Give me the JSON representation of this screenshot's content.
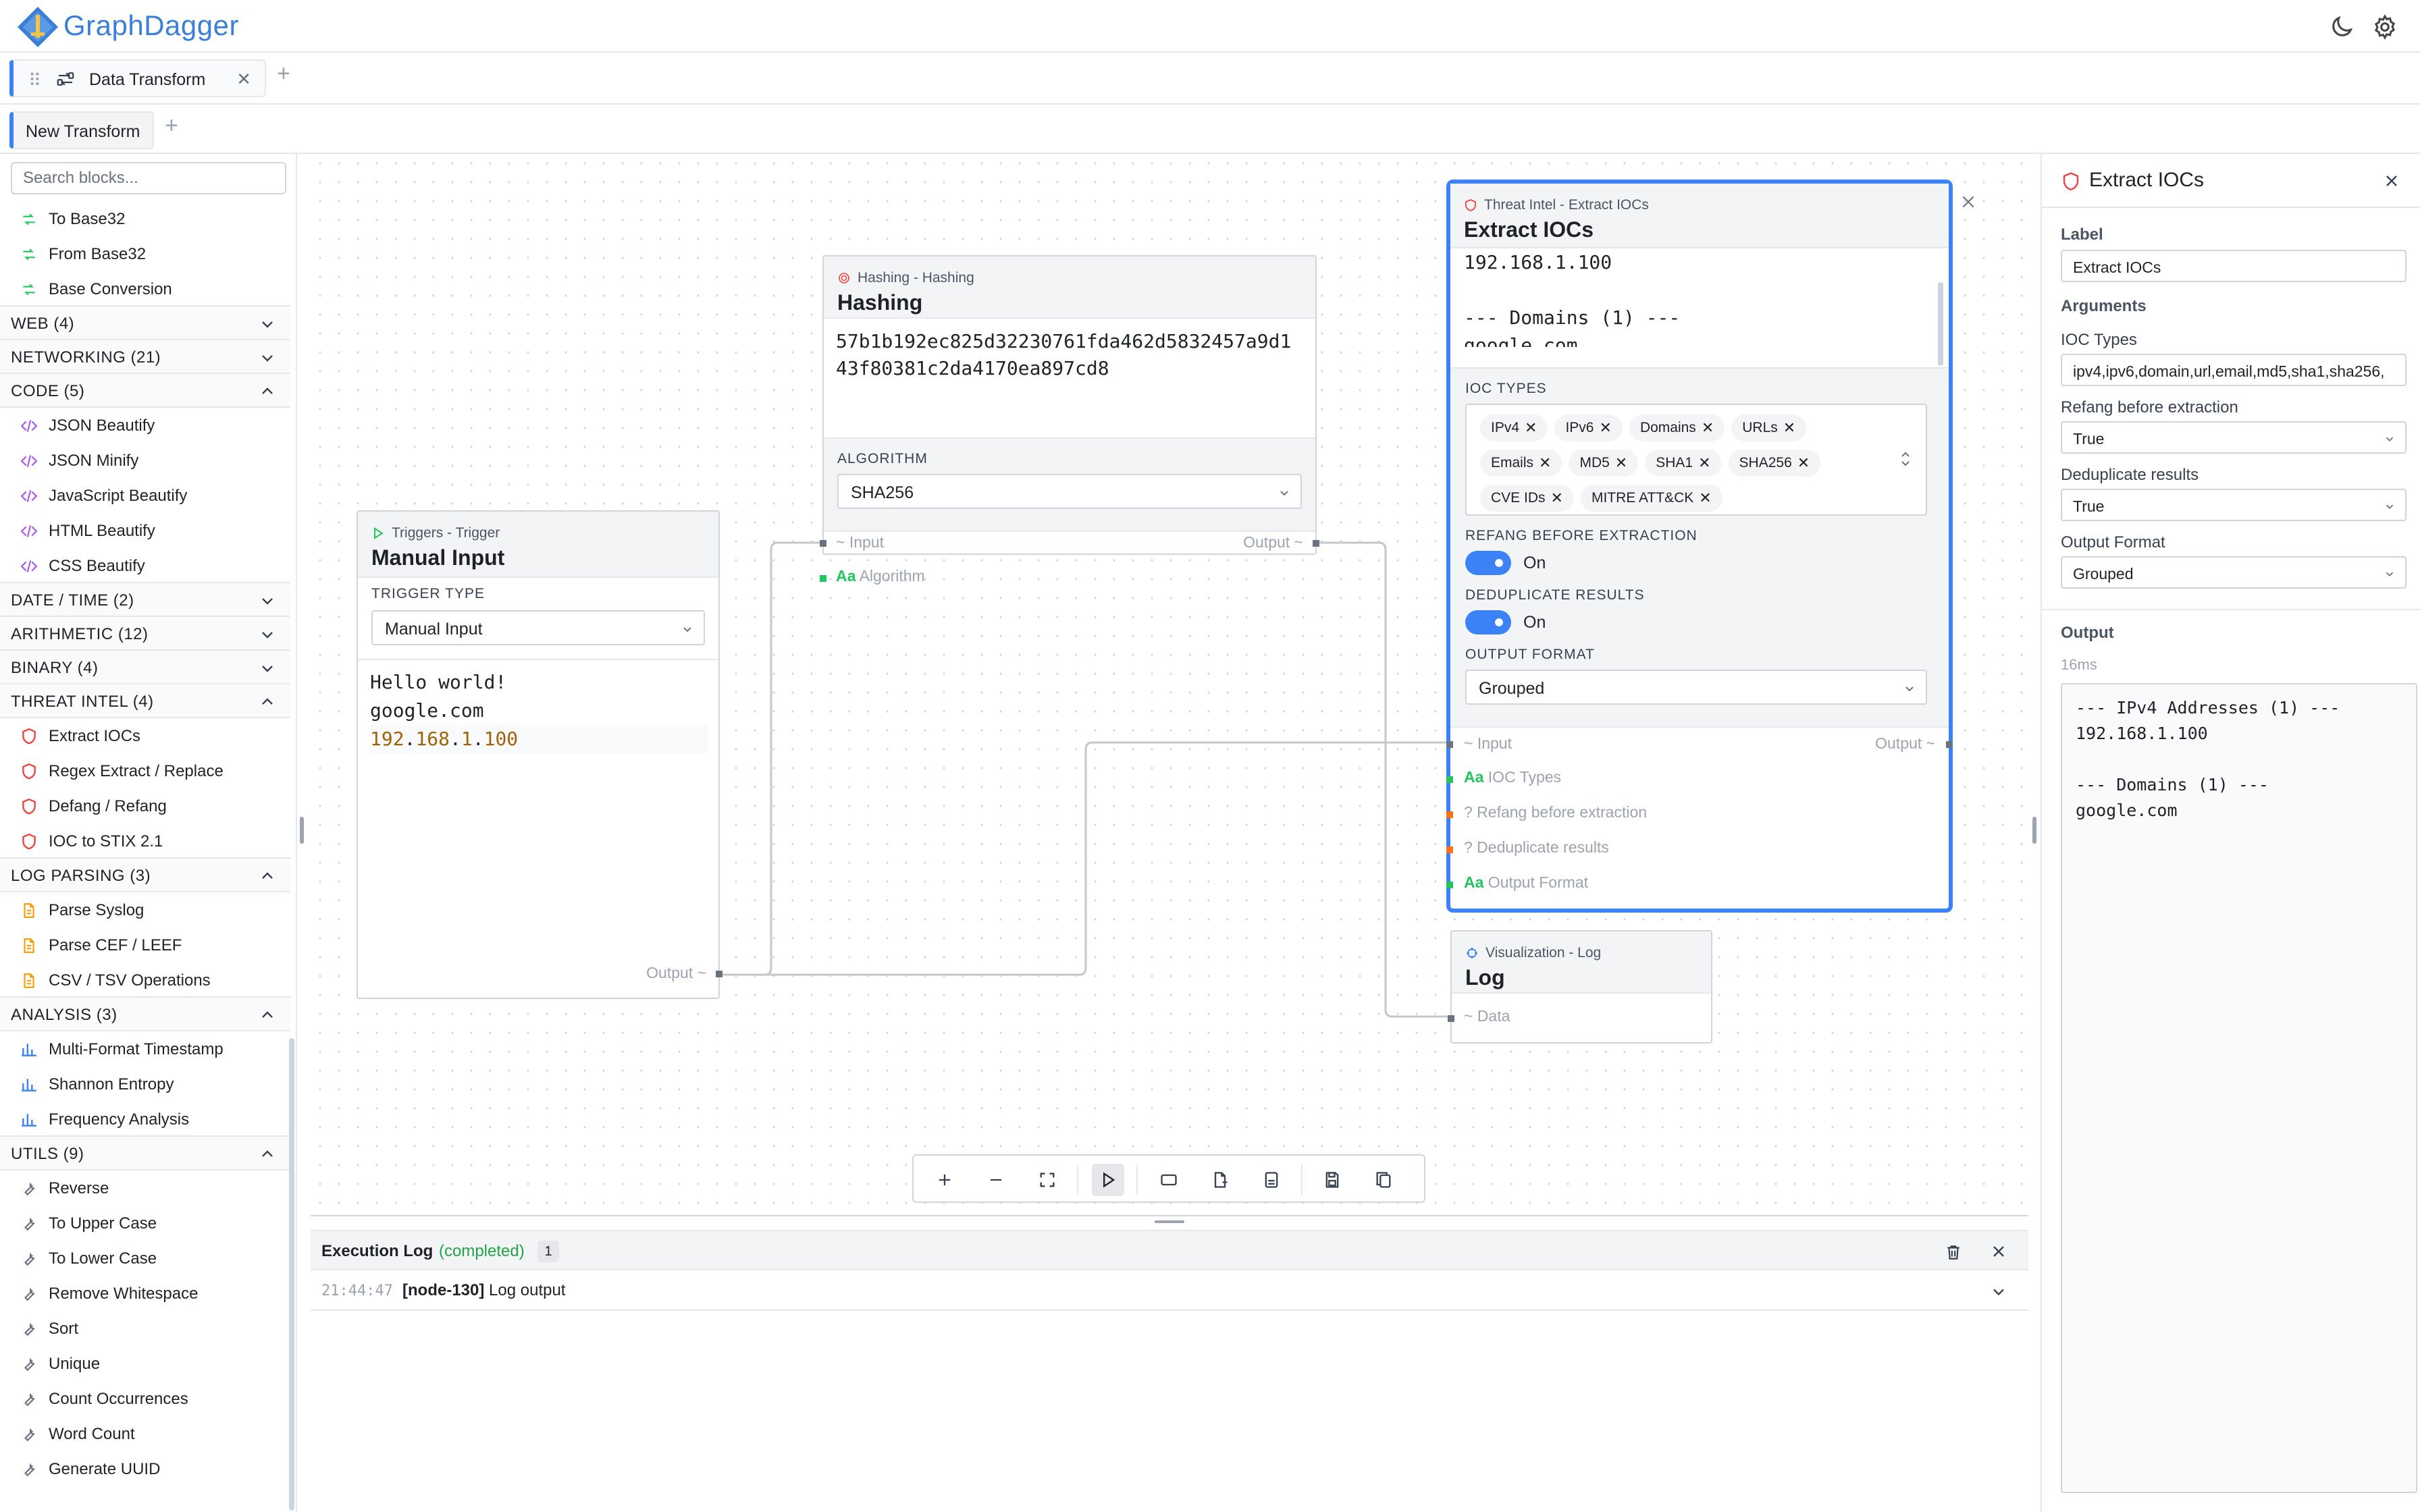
{
  "app": {
    "brand": "GraphDagger",
    "colors": {
      "accent": "#3b82f6",
      "brand": "#3b7fd9",
      "success": "#22a34a"
    }
  },
  "header": {
    "icons": [
      "moon-icon",
      "gear-icon"
    ]
  },
  "tabs": {
    "main": {
      "label": "Data Transform"
    },
    "sub": {
      "label": "New Transform"
    }
  },
  "sidebar": {
    "search_placeholder": "Search blocks...",
    "top_items": [
      "To Base32",
      "From Base32",
      "Base Conversion"
    ],
    "groups": [
      {
        "label": "WEB (4)",
        "expanded": false,
        "items": []
      },
      {
        "label": "NETWORKING (21)",
        "expanded": false,
        "items": []
      },
      {
        "label": "CODE (5)",
        "expanded": true,
        "items": [
          "JSON Beautify",
          "JSON Minify",
          "JavaScript Beautify",
          "HTML Beautify",
          "CSS Beautify"
        ]
      },
      {
        "label": "DATE / TIME (2)",
        "expanded": false,
        "items": []
      },
      {
        "label": "ARITHMETIC (12)",
        "expanded": false,
        "items": []
      },
      {
        "label": "BINARY (4)",
        "expanded": false,
        "items": []
      },
      {
        "label": "THREAT INTEL (4)",
        "expanded": true,
        "items": [
          "Extract IOCs",
          "Regex Extract / Replace",
          "Defang / Refang",
          "IOC to STIX 2.1"
        ]
      },
      {
        "label": "LOG PARSING (3)",
        "expanded": true,
        "items": [
          "Parse Syslog",
          "Parse CEF / LEEF",
          "CSV / TSV Operations"
        ]
      },
      {
        "label": "ANALYSIS (3)",
        "expanded": true,
        "items": [
          "Multi-Format Timestamp",
          "Shannon Entropy",
          "Frequency Analysis"
        ]
      },
      {
        "label": "UTILS (9)",
        "expanded": true,
        "items": [
          "Reverse",
          "To Upper Case",
          "To Lower Case",
          "Remove Whitespace",
          "Sort",
          "Unique",
          "Count Occurrences",
          "Word Count",
          "Generate UUID"
        ]
      }
    ]
  },
  "nodes": {
    "manual": {
      "category": "Triggers - Trigger",
      "title": "Manual Input",
      "field_label": "TRIGGER TYPE",
      "field_value": "Manual Input",
      "lines": [
        "Hello world!",
        "google.com"
      ],
      "ip_parts": [
        "192",
        ".",
        "168",
        ".",
        "1",
        ".",
        "100"
      ],
      "output_label": "Output ~"
    },
    "hashing": {
      "category": "Hashing - Hashing",
      "title": "Hashing",
      "hash_line1": "57b1b192ec825d32230761fda462d5832457a9d1",
      "hash_line2": "43f80381c2da4170ea897cd8",
      "field_label": "ALGORITHM",
      "field_value": "SHA256",
      "in_input": "~ Input",
      "in_algorithm": "Algorithm",
      "out_label": "Output ~"
    },
    "extract": {
      "category": "Threat Intel - Extract IOCs",
      "title": "Extract IOCs",
      "preview": [
        "192.168.1.100",
        "",
        "--- Domains (1) ---",
        "google.com"
      ],
      "ioc_label": "IOC TYPES",
      "chips": [
        "IPv4",
        "IPv6",
        "Domains",
        "URLs",
        "Emails",
        "MD5",
        "SHA1",
        "SHA256",
        "CVE IDs",
        "MITRE ATT&CK"
      ],
      "refang_label": "REFANG BEFORE EXTRACTION",
      "refang_state": "On",
      "dedup_label": "DEDUPLICATE RESULTS",
      "dedup_state": "On",
      "format_label": "OUTPUT FORMAT",
      "format_value": "Grouped",
      "in_input": "~ Input",
      "in_ioc": "IOC Types",
      "in_refang": "? Refang before extraction",
      "in_dedup": "? Deduplicate results",
      "in_format": "Output Format",
      "out_label": "Output ~"
    },
    "log": {
      "category": "Visualization - Log",
      "title": "Log",
      "in_data": "~ Data"
    }
  },
  "exec_log": {
    "title": "Execution Log",
    "status": "(completed)",
    "count": "1",
    "entry": {
      "time": "21:44:47",
      "node": "[node-130]",
      "message": "Log output"
    }
  },
  "right_panel": {
    "title": "Extract IOCs",
    "label_label": "Label",
    "label_value": "Extract IOCs",
    "args_label": "Arguments",
    "ioc_label": "IOC Types",
    "ioc_value": "ipv4,ipv6,domain,url,email,md5,sha1,sha256,",
    "refang_label": "Refang before extraction",
    "refang_value": "True",
    "dedup_label": "Deduplicate results",
    "dedup_value": "True",
    "format_label": "Output Format",
    "format_value": "Grouped",
    "output_label": "Output",
    "timing": "16ms",
    "output_text": "--- IPv4 Addresses (1) ---\n192.168.1.100\n\n--- Domains (1) ---\ngoogle.com"
  }
}
